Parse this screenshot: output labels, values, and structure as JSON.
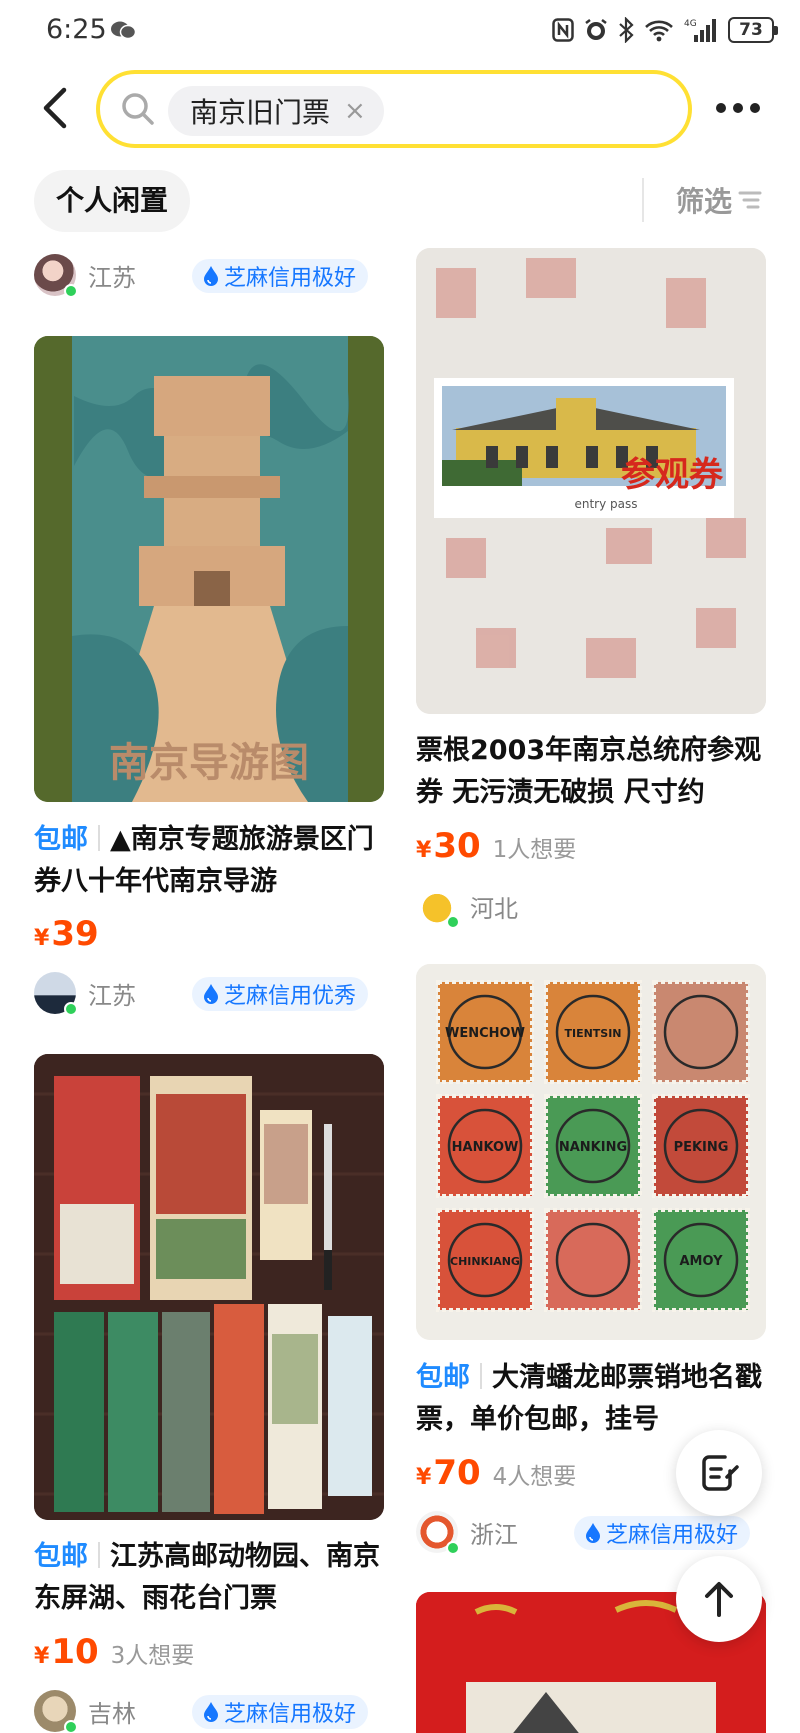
{
  "status_bar": {
    "time": "6:25",
    "battery": "73"
  },
  "search": {
    "query": "南京旧门票",
    "clear_symbol": "×"
  },
  "filters": {
    "chip_label": "个人闲置",
    "filter_label": "筛选"
  },
  "colors": {
    "accent_yellow": "#ffe033",
    "price_orange": "#ff4a00",
    "tag_blue": "#1f8bff",
    "credit_blue": "#1677ff"
  },
  "left_column": {
    "top_seller": {
      "region": "江苏",
      "credit": "芝麻信用极好"
    },
    "item1": {
      "tag": "包邮",
      "title": "▲南京专题旅游景区门券八十年代南京导游",
      "yen": "¥",
      "price": "39",
      "image_text": "南京导游图"
    },
    "item1_seller": {
      "region": "江苏",
      "credit": "芝麻信用优秀"
    },
    "item2": {
      "tag": "包邮",
      "title": "江苏高邮动物园、南京东屏湖、雨花台门票",
      "yen": "¥",
      "price": "10",
      "wants": "3人想要"
    },
    "item2_seller": {
      "region": "吉林",
      "credit": "芝麻信用极好"
    }
  },
  "right_column": {
    "item1": {
      "title": "票根2003年南京总统府参观券 无污渍无破损 尺寸约",
      "yen": "¥",
      "price": "30",
      "wants": "1人想要",
      "image_text": "参观券",
      "image_subtext": "entry pass"
    },
    "item1_seller": {
      "region": "河北"
    },
    "item2": {
      "tag": "包邮",
      "title": "大清蟠龙邮票销地名戳票，单价包邮，挂号",
      "yen": "¥",
      "price": "70",
      "wants": "4人想要",
      "stamp_postmarks": [
        "WENCHOW",
        "TIENTSIN",
        "",
        "HANKOW",
        "NANKING",
        "PEKING",
        "CHINKIANG",
        "",
        "AMOY"
      ]
    },
    "item2_seller": {
      "region": "浙江",
      "credit": "芝麻信用极好"
    }
  },
  "icons": {
    "back": "chevron-left-icon",
    "search": "search-icon",
    "more": "more-dots-icon",
    "filter": "filter-icon",
    "draft": "edit-note-icon",
    "top": "arrow-up-icon"
  }
}
